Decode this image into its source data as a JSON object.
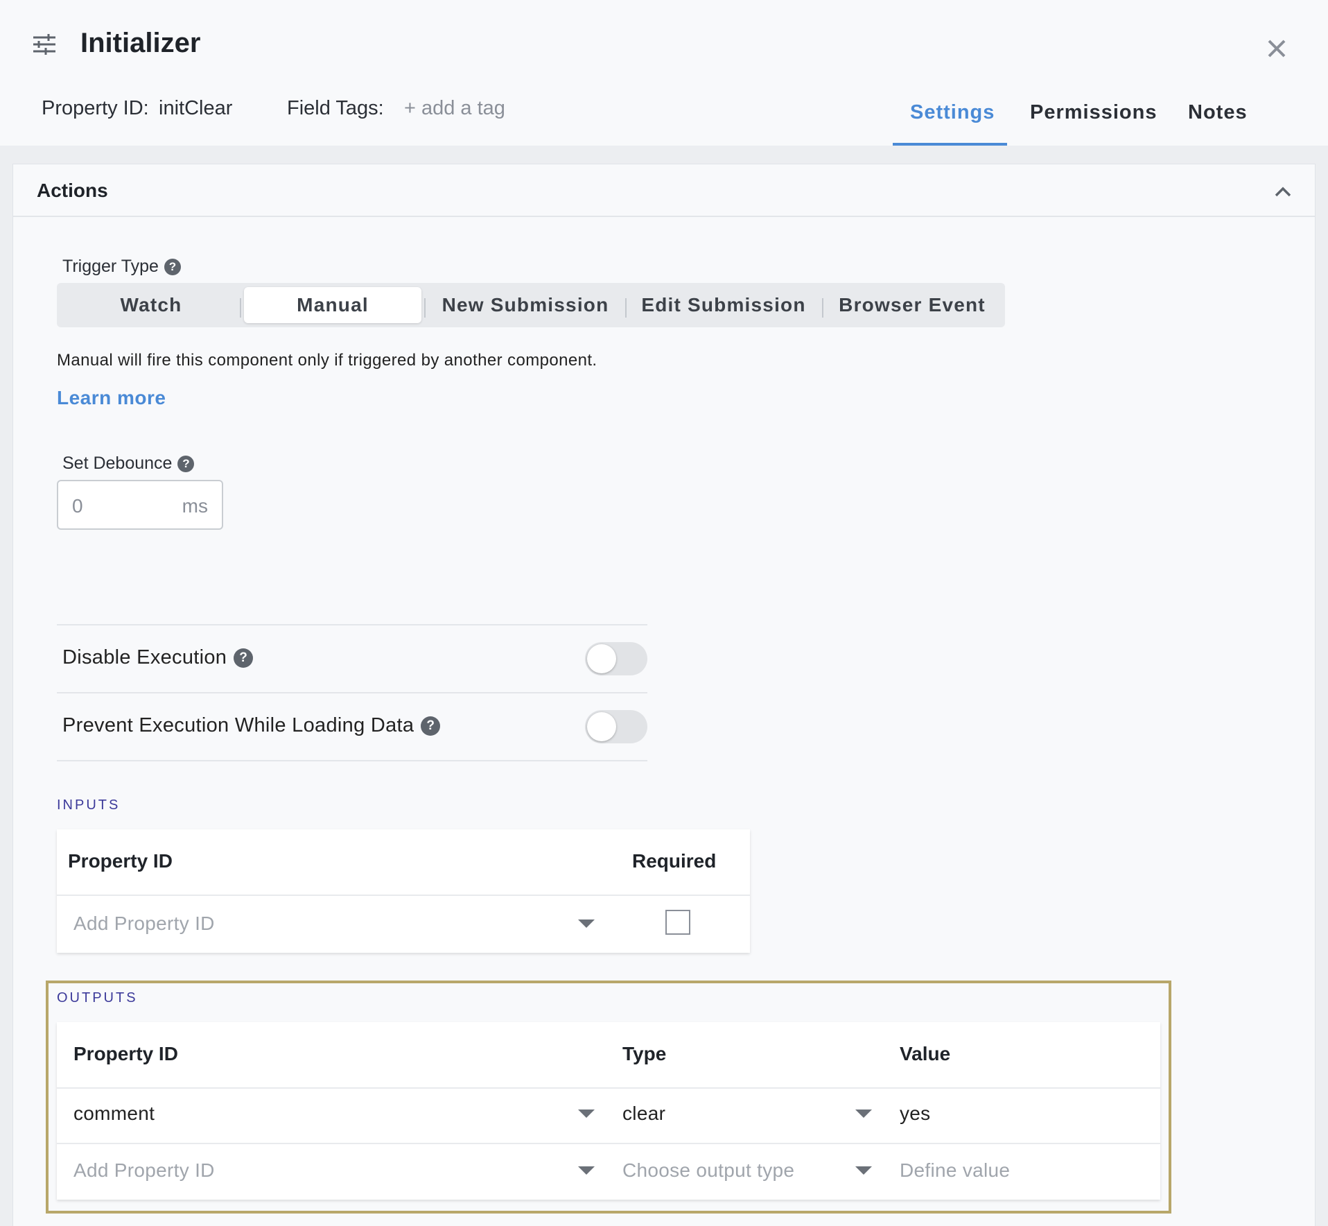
{
  "header": {
    "title": "Initializer",
    "property_id_label": "Property ID:",
    "property_id_value": "initClear",
    "field_tags_label": "Field Tags:",
    "add_tag": "+ add a tag",
    "tabs": [
      {
        "label": "Settings",
        "active": true
      },
      {
        "label": "Permissions",
        "active": false
      },
      {
        "label": "Notes",
        "active": false
      }
    ],
    "accent_color": "#4a8ad6"
  },
  "panel": {
    "title": "Actions",
    "trigger_type_label": "Trigger Type",
    "trigger_options": [
      "Watch",
      "Manual",
      "New Submission",
      "Edit Submission",
      "Browser Event"
    ],
    "trigger_selected": "Manual",
    "trigger_description": "Manual will fire this component only if triggered by another component.",
    "learn_more": "Learn more",
    "debounce_label": "Set Debounce",
    "debounce_value": "0",
    "debounce_unit": "ms",
    "disable_execution_label": "Disable Execution",
    "disable_execution_on": false,
    "prevent_execution_label": "Prevent Execution While Loading Data",
    "prevent_execution_on": false
  },
  "inputs": {
    "section_title": "INPUTS",
    "headers": {
      "property_id": "Property ID",
      "required": "Required"
    },
    "rows": [
      {
        "property_id_placeholder": "Add Property ID",
        "required": false
      }
    ]
  },
  "outputs": {
    "section_title": "OUTPUTS",
    "headers": {
      "property_id": "Property ID",
      "type": "Type",
      "value": "Value"
    },
    "rows": [
      {
        "property_id": "comment",
        "type": "clear",
        "value": "yes"
      }
    ],
    "new_row": {
      "property_id_placeholder": "Add Property ID",
      "type_placeholder": "Choose output type",
      "value_placeholder": "Define value"
    },
    "highlight_color": "#b8a76a"
  }
}
